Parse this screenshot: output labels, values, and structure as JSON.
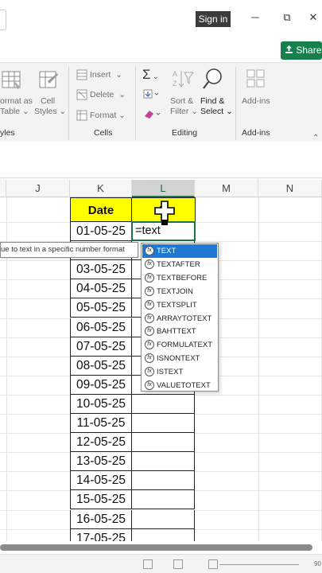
{
  "titlebar": {
    "signin": "Sign in",
    "minimize": "─",
    "restore": "⧉",
    "close": "✕"
  },
  "share": {
    "label": "Share",
    "icon": "share-icon"
  },
  "ribbon": {
    "styles_group": {
      "format_as_table": [
        "ormat as",
        "Table"
      ],
      "cell_styles": [
        "Cell",
        "Styles"
      ],
      "group_label": "yles"
    },
    "cells_group": {
      "insert": "Insert",
      "delete": "Delete",
      "format": "Format",
      "group_label": "Cells"
    },
    "editing_group": {
      "autosum": "Σ",
      "sort_filter": [
        "Sort &",
        "Filter"
      ],
      "find_select": [
        "Find &",
        "Select"
      ],
      "group_label": "Editing"
    },
    "addins_group": {
      "addins": "Add-ins",
      "group_label": "Add-ins"
    }
  },
  "columns": [
    "J",
    "K",
    "L",
    "M",
    "N"
  ],
  "table": {
    "header": "Date",
    "l_header_visible": "D",
    "dates": [
      "01-05-25",
      "02-05-25",
      "03-05-25",
      "04-05-25",
      "05-05-25",
      "06-05-25",
      "07-05-25",
      "08-05-25",
      "09-05-25",
      "10-05-25",
      "11-05-25",
      "12-05-25",
      "13-05-25",
      "14-05-25",
      "15-05-25",
      "16-05-25",
      "17-05-25"
    ],
    "edit_value": "=text"
  },
  "tooltip": "ue to text in a specific number format",
  "autocomplete": {
    "items": [
      "TEXT",
      "TEXTAFTER",
      "TEXTBEFORE",
      "TEXTJOIN",
      "TEXTSPLIT",
      "ARRAYTOTEXT",
      "BAHTTEXT",
      "FORMULATEXT",
      "ISNONTEXT",
      "ISTEXT",
      "VALUETOTEXT"
    ],
    "selected_index": 0,
    "icon": "fx"
  },
  "status": {
    "zoom": "90"
  },
  "colors": {
    "accent_green": "#217346",
    "share_green": "#16804a",
    "header_yellow": "#ffff00",
    "selection_blue": "#1f78d1"
  }
}
